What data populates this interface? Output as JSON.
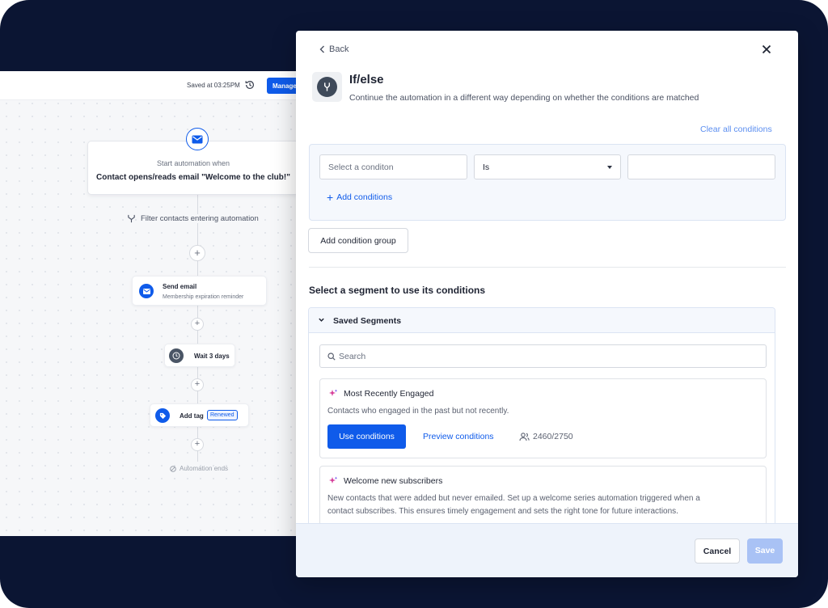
{
  "builder": {
    "saved_at": "Saved at 03:25PM",
    "manage_label": "Manage",
    "start_label": "Start automation when",
    "trigger": "Contact opens/reads email \"Welcome to the club!\"",
    "filter_label": "Filter contacts entering automation",
    "send_email": {
      "title": "Send email",
      "subtitle": "Membership expiration reminder"
    },
    "wait": {
      "title": "Wait 3 days"
    },
    "add_tag": {
      "title": "Add tag",
      "tag": "Renewed"
    },
    "ends_label": "Automation ends"
  },
  "modal": {
    "back_label": "Back",
    "title": "If/else",
    "description": "Continue the automation in a different way depending on whether the conditions are matched",
    "clear_all": "Clear all conditions",
    "condition": {
      "field_placeholder": "Select a conditon",
      "operator": "Is",
      "value": ""
    },
    "add_conditions": "Add conditions",
    "add_group": "Add condition group",
    "segment_heading": "Select a segment to use its conditions",
    "saved_segments": "Saved Segments",
    "search_placeholder": "Search",
    "segments": [
      {
        "name": "Most Recently Engaged",
        "description": "Contacts who engaged in the past but not recently.",
        "use_label": "Use conditions",
        "preview_label": "Preview conditions",
        "count": "2460/2750"
      },
      {
        "name": "Welcome new subscribers",
        "description_line1": "New contacts that were added but never emailed. Set up a welcome series automation triggered when a",
        "description_line2": "contact subscribes. This ensures timely engagement and sets the right tone for future interactions."
      }
    ],
    "cancel_label": "Cancel",
    "save_label": "Save"
  },
  "colors": {
    "frame": "#0b1533",
    "accent": "#0f5bea",
    "save_disabled": "#a9c2f5",
    "sparkle": "#d63f9a"
  }
}
